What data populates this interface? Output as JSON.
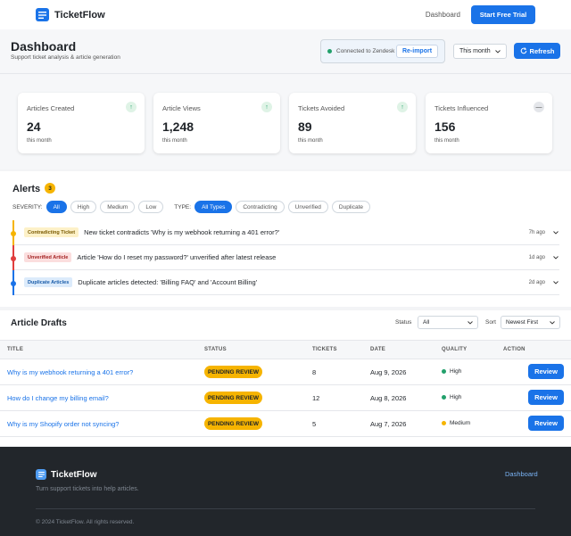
{
  "nav": {
    "brand": "TicketFlow",
    "link": "Dashboard",
    "cta": "Start Free Trial"
  },
  "header": {
    "title": "Dashboard",
    "subtitle": "Support ticket analysis & article generation",
    "connection": "Connected to Zendesk",
    "reimport": "Re-import",
    "period": "This month",
    "refresh": "Refresh"
  },
  "stats": [
    {
      "label": "Articles Created",
      "value": "24",
      "sub": "this month",
      "trend": "up",
      "trend_icon": "↑"
    },
    {
      "label": "Article Views",
      "value": "1,248",
      "sub": "this month",
      "trend": "up",
      "trend_icon": "↑"
    },
    {
      "label": "Tickets Avoided",
      "value": "89",
      "sub": "this month",
      "trend": "up",
      "trend_icon": "↑"
    },
    {
      "label": "Tickets Influenced",
      "value": "156",
      "sub": "this month",
      "trend": "flat",
      "trend_icon": "—"
    }
  ],
  "alerts": {
    "title": "Alerts",
    "count": "3",
    "severity_label": "SEVERITY:",
    "severity": [
      "All",
      "High",
      "Medium",
      "Low"
    ],
    "type_label": "TYPE:",
    "types": [
      "All Types",
      "Contradicting",
      "Unverified",
      "Duplicate"
    ],
    "items": [
      {
        "tag": "Contradicting Ticket",
        "message": "New ticket contradicts 'Why is my webhook returning a 401 error?'",
        "time": "7h ago",
        "color": "#f6b400",
        "tag_bg": "#fdf1c8",
        "tag_fg": "#7a5a00"
      },
      {
        "tag": "Unverified Article",
        "message": "Article 'How do I reset my password?' unverified after latest release",
        "time": "1d ago",
        "color": "#e03e3e",
        "tag_bg": "#fbdede",
        "tag_fg": "#a32020"
      },
      {
        "tag": "Duplicate Articles",
        "message": "Duplicate articles detected: 'Billing FAQ' and 'Account Billing'",
        "time": "2d ago",
        "color": "#1a73e8",
        "tag_bg": "#dcebfb",
        "tag_fg": "#175aa8"
      }
    ]
  },
  "drafts": {
    "title": "Article Drafts",
    "status_label": "Status",
    "status_value": "All",
    "sort_label": "Sort",
    "sort_value": "Newest First",
    "columns": [
      "TITLE",
      "STATUS",
      "TICKETS",
      "DATE",
      "QUALITY",
      "ACTION"
    ],
    "rows": [
      {
        "title": "Why is my webhook returning a 401 error?",
        "status": "PENDING REVIEW",
        "tickets": "8",
        "date": "Aug 9, 2026",
        "quality": "High",
        "qcolor": "#22a06b",
        "action": "Review"
      },
      {
        "title": "How do I change my billing email?",
        "status": "PENDING REVIEW",
        "tickets": "12",
        "date": "Aug 8, 2026",
        "quality": "High",
        "qcolor": "#22a06b",
        "action": "Review"
      },
      {
        "title": "Why is my Shopify order not syncing?",
        "status": "PENDING REVIEW",
        "tickets": "5",
        "date": "Aug 7, 2026",
        "quality": "Medium",
        "qcolor": "#f6b400",
        "action": "Review"
      }
    ]
  },
  "footer": {
    "brand": "TicketFlow",
    "tagline": "Turn support tickets into help articles.",
    "link": "Dashboard",
    "copyright": "© 2024 TicketFlow. All rights reserved."
  },
  "colors": {
    "accent": "#1a73e8",
    "warning": "#f6b400",
    "success": "#22a06b",
    "danger": "#e03e3e",
    "footer": "#22262b"
  }
}
